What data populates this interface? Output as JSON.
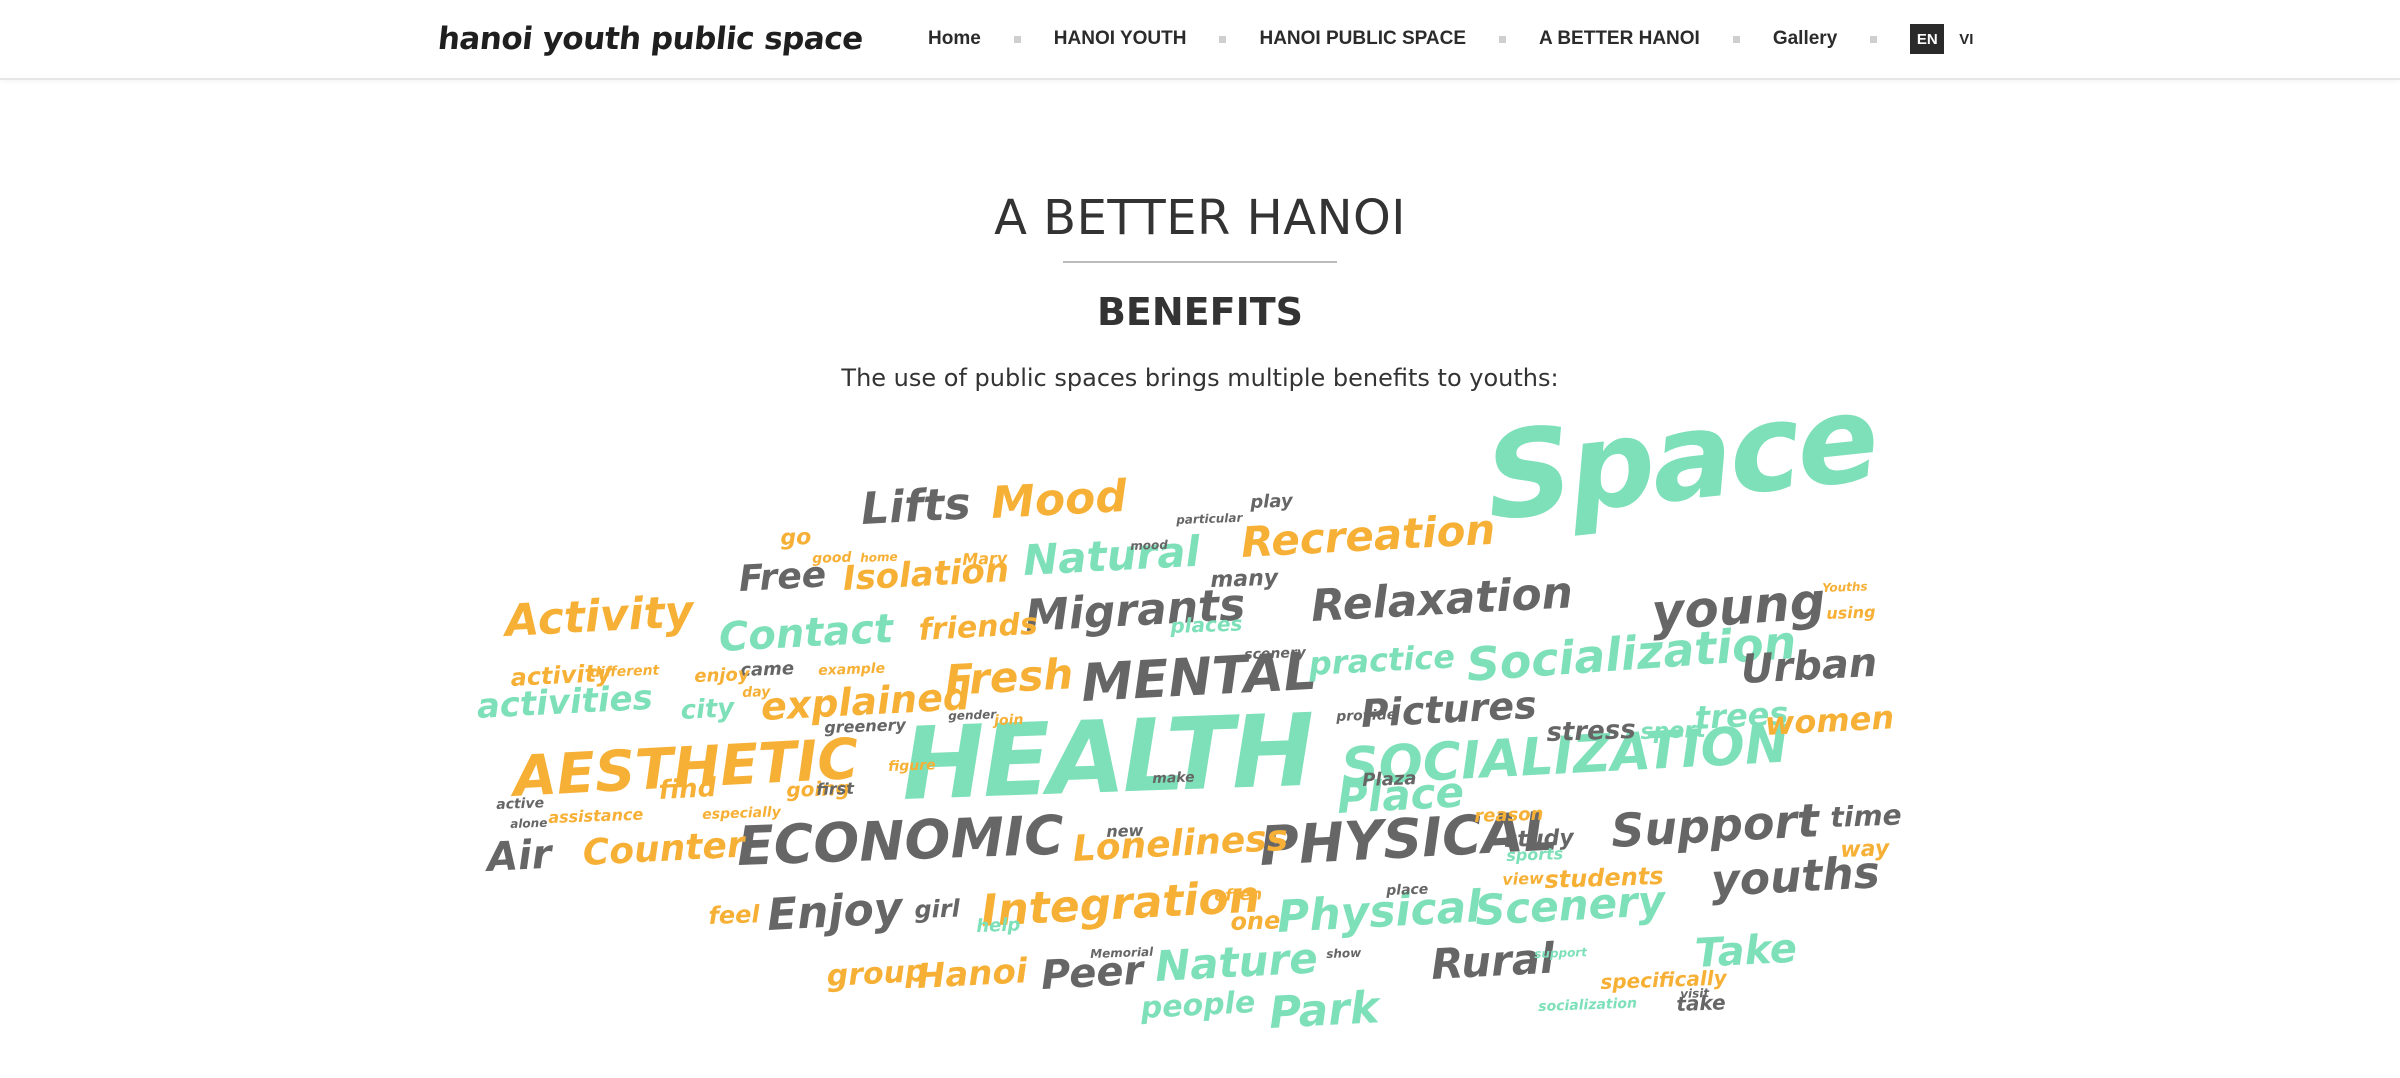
{
  "header": {
    "logo_text": "hanoi youth public space",
    "nav": [
      "Home",
      "HANOI YOUTH",
      "HANOI PUBLIC SPACE",
      "A BETTER HANOI",
      "Gallery"
    ],
    "lang_active": "EN",
    "lang_other": "VI"
  },
  "main": {
    "title": "A BETTER HANOI",
    "subtitle": "BENEFITS",
    "intro": "The use of public spaces brings multiple benefits to youths:"
  },
  "word_cloud": {
    "words": [
      {
        "text": "Space",
        "color": "green"
      },
      {
        "text": "HEALTH",
        "color": "green"
      },
      {
        "text": "SOCIALIZATION",
        "color": "green"
      },
      {
        "text": "Socialization",
        "color": "green"
      },
      {
        "text": "AESTHETIC",
        "color": "orange"
      },
      {
        "text": "ECONOMIC",
        "color": "grey"
      },
      {
        "text": "PHYSICAL",
        "color": "grey"
      },
      {
        "text": "MENTAL",
        "color": "grey"
      },
      {
        "text": "Recreation",
        "color": "orange"
      },
      {
        "text": "Relaxation",
        "color": "grey"
      },
      {
        "text": "Migrants",
        "color": "grey"
      },
      {
        "text": "Natural",
        "color": "green"
      },
      {
        "text": "Mood",
        "color": "orange"
      },
      {
        "text": "Lifts",
        "color": "grey"
      },
      {
        "text": "Isolation",
        "color": "orange"
      },
      {
        "text": "Free",
        "color": "grey"
      },
      {
        "text": "Activity",
        "color": "orange"
      },
      {
        "text": "Contact",
        "color": "green"
      },
      {
        "text": "friends",
        "color": "orange"
      },
      {
        "text": "young",
        "color": "grey"
      },
      {
        "text": "Urban",
        "color": "grey"
      },
      {
        "text": "practice",
        "color": "green"
      },
      {
        "text": "Pictures",
        "color": "grey"
      },
      {
        "text": "trees",
        "color": "green"
      },
      {
        "text": "women",
        "color": "orange"
      },
      {
        "text": "Fresh",
        "color": "orange"
      },
      {
        "text": "explained",
        "color": "orange"
      },
      {
        "text": "activities",
        "color": "green"
      },
      {
        "text": "city",
        "color": "green"
      },
      {
        "text": "activity",
        "color": "orange"
      },
      {
        "text": "Place",
        "color": "green"
      },
      {
        "text": "stress",
        "color": "grey"
      },
      {
        "text": "sport",
        "color": "green"
      },
      {
        "text": "Support",
        "color": "grey"
      },
      {
        "text": "time",
        "color": "grey"
      },
      {
        "text": "way",
        "color": "orange"
      },
      {
        "text": "youths",
        "color": "grey"
      },
      {
        "text": "Air",
        "color": "grey"
      },
      {
        "text": "Counter",
        "color": "orange"
      },
      {
        "text": "Loneliness",
        "color": "orange"
      },
      {
        "text": "Enjoy",
        "color": "grey"
      },
      {
        "text": "Integration",
        "color": "orange"
      },
      {
        "text": "Physical",
        "color": "green"
      },
      {
        "text": "Scenery",
        "color": "green"
      },
      {
        "text": "Take",
        "color": "green"
      },
      {
        "text": "Rural",
        "color": "grey"
      },
      {
        "text": "Nature",
        "color": "green"
      },
      {
        "text": "Park",
        "color": "green"
      },
      {
        "text": "Peer",
        "color": "grey"
      },
      {
        "text": "Hanoi",
        "color": "orange"
      },
      {
        "text": "group",
        "color": "orange"
      },
      {
        "text": "people",
        "color": "green"
      },
      {
        "text": "students",
        "color": "orange"
      },
      {
        "text": "study",
        "color": "grey"
      },
      {
        "text": "girl",
        "color": "grey"
      },
      {
        "text": "feel",
        "color": "orange"
      },
      {
        "text": "find",
        "color": "orange"
      },
      {
        "text": "going",
        "color": "orange"
      },
      {
        "text": "many",
        "color": "grey"
      },
      {
        "text": "play",
        "color": "grey"
      },
      {
        "text": "go",
        "color": "orange"
      },
      {
        "text": "places",
        "color": "green"
      },
      {
        "text": "Plaza",
        "color": "grey"
      },
      {
        "text": "reason",
        "color": "orange"
      },
      {
        "text": "one",
        "color": "orange"
      },
      {
        "text": "help",
        "color": "green"
      },
      {
        "text": "new",
        "color": "grey"
      },
      {
        "text": "take",
        "color": "grey"
      },
      {
        "text": "specifically",
        "color": "orange"
      },
      {
        "text": "view",
        "color": "orange"
      },
      {
        "text": "sports",
        "color": "green"
      },
      {
        "text": "came",
        "color": "grey"
      },
      {
        "text": "first",
        "color": "grey"
      },
      {
        "text": "enjoy",
        "color": "orange"
      },
      {
        "text": "assistance",
        "color": "orange"
      },
      {
        "text": "greenery",
        "color": "grey"
      },
      {
        "text": "using",
        "color": "orange"
      },
      {
        "text": "Youths",
        "color": "orange"
      },
      {
        "text": "active",
        "color": "grey"
      },
      {
        "text": "day",
        "color": "orange"
      },
      {
        "text": "socialization",
        "color": "green"
      },
      {
        "text": "provide",
        "color": "grey"
      },
      {
        "text": "scenery",
        "color": "grey"
      },
      {
        "text": "especially",
        "color": "orange"
      },
      {
        "text": "Memorial",
        "color": "grey"
      },
      {
        "text": "often",
        "color": "orange"
      },
      {
        "text": "particular",
        "color": "grey"
      },
      {
        "text": "good",
        "color": "orange"
      },
      {
        "text": "home",
        "color": "orange"
      },
      {
        "text": "Mary",
        "color": "orange"
      },
      {
        "text": "mood",
        "color": "grey"
      },
      {
        "text": "gender",
        "color": "grey"
      },
      {
        "text": "make",
        "color": "grey"
      },
      {
        "text": "show",
        "color": "grey"
      },
      {
        "text": "alone",
        "color": "grey"
      },
      {
        "text": "support",
        "color": "green"
      },
      {
        "text": "visit",
        "color": "grey"
      },
      {
        "text": "join",
        "color": "orange"
      },
      {
        "text": "different",
        "color": "orange"
      },
      {
        "text": "example",
        "color": "orange"
      },
      {
        "text": "figure",
        "color": "orange"
      },
      {
        "text": "place",
        "color": "grey"
      }
    ]
  }
}
